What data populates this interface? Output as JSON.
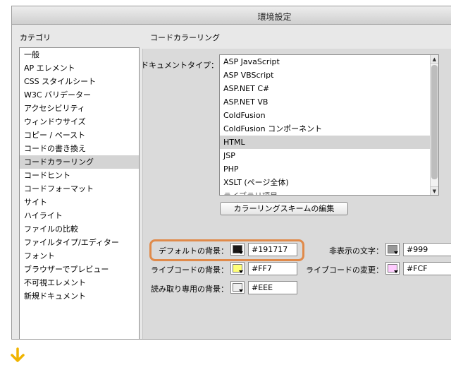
{
  "window": {
    "title": "環境設定"
  },
  "sidebar": {
    "label": "カテゴリ",
    "items": [
      "一般",
      "AP エレメント",
      "CSS スタイルシート",
      "W3C バリデーター",
      "アクセシビリティ",
      "ウィンドウサイズ",
      "コピー / ペースト",
      "コードの書き換え",
      "コードカラーリング",
      "コードヒント",
      "コードフォーマット",
      "サイト",
      "ハイライト",
      "ファイルの比較",
      "ファイルタイプ/エディター",
      "フォント",
      "ブラウザーでプレビュー",
      "不可視エレメント",
      "新規ドキュメント"
    ],
    "selected": "コードカラーリング"
  },
  "main": {
    "title": "コードカラーリング",
    "doc_type_label": "ドキュメントタイプ：",
    "doc_types": [
      "ASP JavaScript",
      "ASP VBScript",
      "ASP.NET C#",
      "ASP.NET VB",
      "ColdFusion",
      "ColdFusion コンポーネント",
      "HTML",
      "JSP",
      "PHP",
      "XSLT (ページ全体)",
      "ライブラリ項目"
    ],
    "doc_selected": "HTML",
    "edit_button": "カラーリングスキームの編集"
  },
  "colors": {
    "default_bg": {
      "label": "デフォルトの背景：",
      "value": "#191717",
      "swatch": "#191717"
    },
    "hidden_text": {
      "label": "非表示の文字：",
      "value": "#999",
      "swatch": "#999999"
    },
    "live_code_bg": {
      "label": "ライブコードの背景：",
      "value": "#FF7",
      "swatch": "#FFFF77"
    },
    "live_code_change": {
      "label": "ライブコードの変更：",
      "value": "#FCF",
      "swatch": "#FFCCFF"
    },
    "readonly_bg": {
      "label": "読み取り専用の背景：",
      "value": "#EEE",
      "swatch": "#EEEEEE"
    }
  },
  "accent": {
    "highlight": "#E08A4A",
    "arrow": "#F0B400"
  },
  "icons": {
    "arrow": "arrow-down-icon"
  }
}
